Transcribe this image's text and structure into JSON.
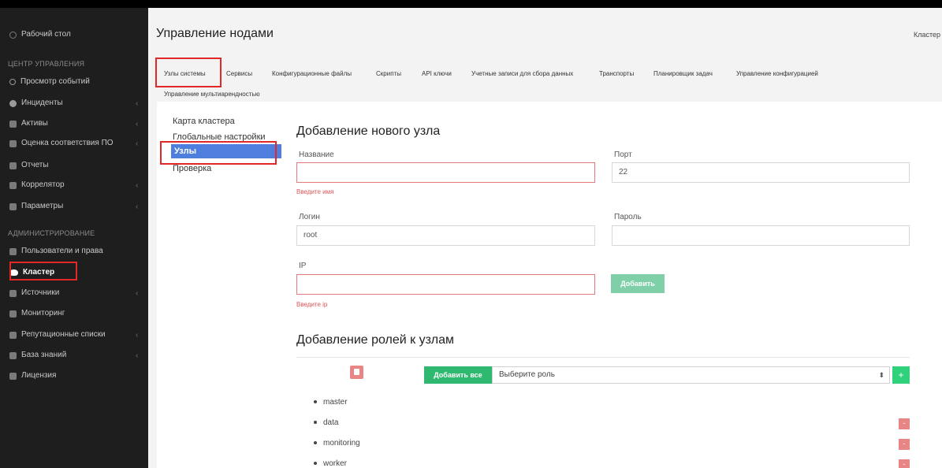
{
  "sidebar": {
    "desktop": "Рабочий стол",
    "section_control": "ЦЕНТР УПРАВЛЕНИЯ",
    "section_admin": "АДМИНИСТРИРОВАНИЕ",
    "items": {
      "events": "Просмотр событий",
      "incidents": "Инциденты",
      "assets": "Активы",
      "compliance": "Оценка соответствия ПО",
      "reports": "Отчеты",
      "correlator": "Коррелятор",
      "parameters": "Параметры",
      "users": "Пользователи и права",
      "cluster": "Кластер",
      "sources": "Источники",
      "monitoring": "Мониторинг",
      "reputation": "Репутационные списки",
      "knowledge": "База знаний",
      "license": "Лицензия"
    },
    "chevron": "‹"
  },
  "header": {
    "title": "Управление нодами",
    "right": "Кластер"
  },
  "tabs": {
    "system_nodes": "Узлы системы",
    "services": "Сервисы",
    "config_files": "Конфигурационные файлы",
    "scripts": "Скрипты",
    "api_keys": "API ключи",
    "accounts": "Учетные записи для сбора данных",
    "transports": "Транспорты",
    "scheduler": "Планировщик задач",
    "config_mgmt": "Управление конфигурацией",
    "multitenancy": "Управление мультиарендностью"
  },
  "left_nav": {
    "cluster_map": "Карта кластера",
    "global_settings": "Глобальные настройки",
    "nodes": "Узлы",
    "check": "Проверка"
  },
  "form": {
    "title": "Добавление нового узла",
    "name_label": "Название",
    "name_value": "",
    "name_error": "Введите имя",
    "port_label": "Порт",
    "port_value": "22",
    "login_label": "Логин",
    "login_value": "root",
    "password_label": "Пароль",
    "password_value": "",
    "ip_label": "IP",
    "ip_value": "",
    "ip_error": "Введите ip",
    "add_button": "Добавить"
  },
  "roles": {
    "title": "Добавление ролей к узлам",
    "add_all": "Добавить все",
    "select_placeholder": "Выберите роль",
    "select_arrow": "⬍",
    "plus": "+",
    "minus": "-",
    "items": [
      "master",
      "data",
      "monitoring",
      "worker"
    ]
  },
  "colors": {
    "highlight": "#e32626",
    "active_nav": "#4f7fde",
    "green": "#2fb86f",
    "error": "#e05555"
  }
}
